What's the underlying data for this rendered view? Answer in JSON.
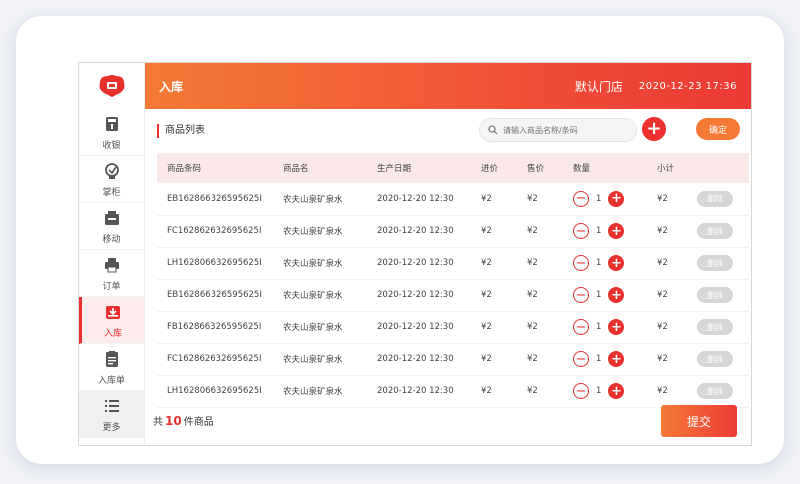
{
  "header": {
    "title": "入库",
    "store": "默认门店",
    "time": "2020-12-23 17:36"
  },
  "sidebar": {
    "items": [
      {
        "label": "收银",
        "icon": "cashier-icon",
        "active": false
      },
      {
        "label": "掌柜",
        "icon": "manager-icon",
        "active": false
      },
      {
        "label": "移动",
        "icon": "mobile-icon",
        "active": false
      },
      {
        "label": "订单",
        "icon": "printer-icon",
        "active": false
      },
      {
        "label": "入库",
        "icon": "inbox-icon",
        "active": true
      },
      {
        "label": "入库单",
        "icon": "document-icon",
        "active": false
      },
      {
        "label": "更多",
        "icon": "list-icon",
        "active": false
      }
    ]
  },
  "main": {
    "section_title": "商品列表",
    "search_placeholder": "请输入商品名称/条码",
    "confirm_label": "确定",
    "submit_label": "提交",
    "total_prefix": "共",
    "total_count": "10",
    "total_suffix": "件商品",
    "columns": [
      "商品条码",
      "商品名",
      "生产日期",
      "进价",
      "售价",
      "数量",
      "小计"
    ],
    "rows": [
      {
        "barcode": "EB162866326595625I",
        "name": "农夫山泉矿泉水",
        "date": "2020-12-20 12:30",
        "cost": "¥2",
        "price": "¥2",
        "qty": "1",
        "subtotal": "¥2",
        "delete": "删除"
      },
      {
        "barcode": "FC162862632695625I",
        "name": "农夫山泉矿泉水",
        "date": "2020-12-20 12:30",
        "cost": "¥2",
        "price": "¥2",
        "qty": "1",
        "subtotal": "¥2",
        "delete": "删除"
      },
      {
        "barcode": "LH162806632695625I",
        "name": "农夫山泉矿泉水",
        "date": "2020-12-20 12:30",
        "cost": "¥2",
        "price": "¥2",
        "qty": "1",
        "subtotal": "¥2",
        "delete": "删除"
      },
      {
        "barcode": "EB162866326595625I",
        "name": "农夫山泉矿泉水",
        "date": "2020-12-20 12:30",
        "cost": "¥2",
        "price": "¥2",
        "qty": "1",
        "subtotal": "¥2",
        "delete": "删除"
      },
      {
        "barcode": "FB162866326595625I",
        "name": "农夫山泉矿泉水",
        "date": "2020-12-20 12:30",
        "cost": "¥2",
        "price": "¥2",
        "qty": "1",
        "subtotal": "¥2",
        "delete": "删除"
      },
      {
        "barcode": "FC162862632695625I",
        "name": "农夫山泉矿泉水",
        "date": "2020-12-20 12:30",
        "cost": "¥2",
        "price": "¥2",
        "qty": "1",
        "subtotal": "¥2",
        "delete": "删除"
      },
      {
        "barcode": "LH162806632695625I",
        "name": "农夫山泉矿泉水",
        "date": "2020-12-20 12:30",
        "cost": "¥2",
        "price": "¥2",
        "qty": "1",
        "subtotal": "¥2",
        "delete": "删除"
      }
    ]
  },
  "colors": {
    "accent": "#e8302f",
    "header_start": "#f47a35",
    "header_end": "#ec3a35"
  }
}
